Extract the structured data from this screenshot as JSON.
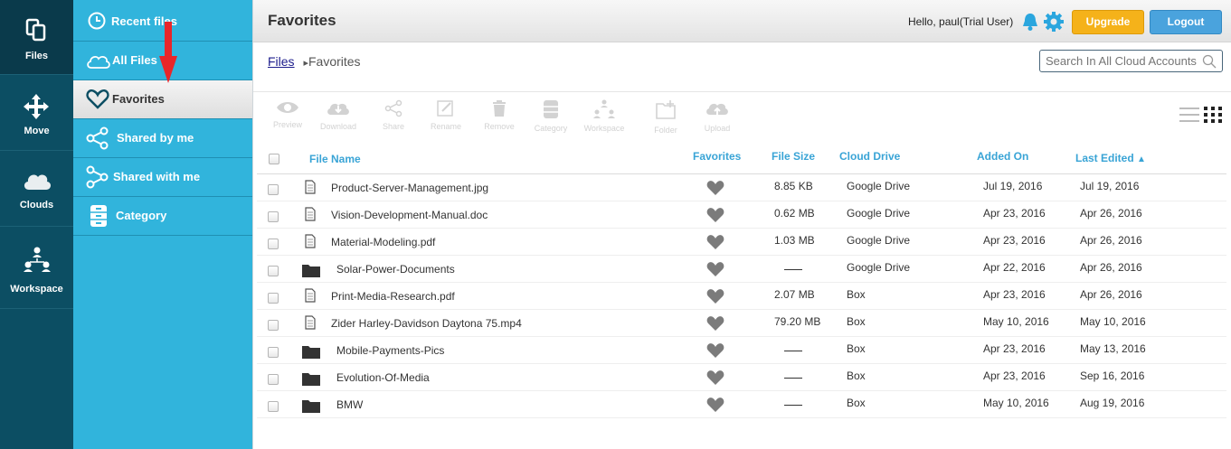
{
  "rail": {
    "items": [
      {
        "label": "Files",
        "icon": "files-icon"
      },
      {
        "label": "Move",
        "icon": "move-icon"
      },
      {
        "label": "Clouds",
        "icon": "cloud-icon"
      },
      {
        "label": "Workspace",
        "icon": "workspace-icon"
      }
    ]
  },
  "subnav": {
    "items": [
      {
        "label": "Recent files",
        "icon": "clock-icon"
      },
      {
        "label": "All Files",
        "icon": "cloud-outline-icon"
      },
      {
        "label": "Favorites",
        "icon": "heart-icon"
      },
      {
        "label": "Shared by me",
        "icon": "share-icon"
      },
      {
        "label": "Shared with me",
        "icon": "share-with-icon"
      },
      {
        "label": "Category",
        "icon": "cabinet-icon"
      }
    ]
  },
  "header": {
    "title": "Favorites",
    "greeting": "Hello, paul(Trial User)",
    "upgrade_label": "Upgrade",
    "logout_label": "Logout"
  },
  "breadcrumb": {
    "root": "Files",
    "separator": "▸",
    "current": "Favorites"
  },
  "search": {
    "placeholder": "Search In All Cloud Accounts"
  },
  "toolbar": {
    "items": [
      "Preview",
      "Download",
      "Share",
      "Rename",
      "Remove",
      "Category",
      "Workspace",
      "Folder",
      "Upload"
    ]
  },
  "table": {
    "headers": {
      "file_name": "File Name",
      "favorites": "Favorites",
      "file_size": "File Size",
      "cloud_drive": "Cloud Drive",
      "added_on": "Added On",
      "last_edited": "Last Edited",
      "sort_indicator": "▲"
    },
    "rows": [
      {
        "type": "file",
        "name": "Product-Server-Management.jpg",
        "size": "8.85 KB",
        "drive": "Google Drive",
        "added": "Jul 19, 2016",
        "edited": "Jul 19, 2016"
      },
      {
        "type": "file",
        "name": "Vision-Development-Manual.doc",
        "size": "0.62 MB",
        "drive": "Google Drive",
        "added": "Apr 23, 2016",
        "edited": "Apr 26, 2016"
      },
      {
        "type": "file",
        "name": "Material-Modeling.pdf",
        "size": "1.03 MB",
        "drive": "Google Drive",
        "added": "Apr 23, 2016",
        "edited": "Apr 26, 2016"
      },
      {
        "type": "folder",
        "name": "Solar-Power-Documents",
        "size": "",
        "drive": "Google Drive",
        "added": "Apr 22, 2016",
        "edited": "Apr 26, 2016"
      },
      {
        "type": "file",
        "name": "Print-Media-Research.pdf",
        "size": "2.07 MB",
        "drive": "Box",
        "added": "Apr 23, 2016",
        "edited": "Apr 26, 2016"
      },
      {
        "type": "file",
        "name": "Zider Harley-Davidson Daytona 75.mp4",
        "size": "79.20 MB",
        "drive": "Box",
        "added": "May 10, 2016",
        "edited": "May 10, 2016"
      },
      {
        "type": "folder",
        "name": "Mobile-Payments-Pics",
        "size": "",
        "drive": "Box",
        "added": "Apr 23, 2016",
        "edited": "May 13, 2016"
      },
      {
        "type": "folder",
        "name": "Evolution-Of-Media",
        "size": "",
        "drive": "Box",
        "added": "Apr 23, 2016",
        "edited": "Sep 16, 2016"
      },
      {
        "type": "folder",
        "name": "BMW",
        "size": "",
        "drive": "Box",
        "added": "May 10, 2016",
        "edited": "Aug 19, 2016"
      }
    ]
  },
  "colors": {
    "rail": "#0c4e63",
    "subnav": "#31b4dc",
    "upgrade": "#f5b21a",
    "logout": "#4aa3dd",
    "header_text": "#39a4d6",
    "annotation_arrow": "#e8262a"
  }
}
